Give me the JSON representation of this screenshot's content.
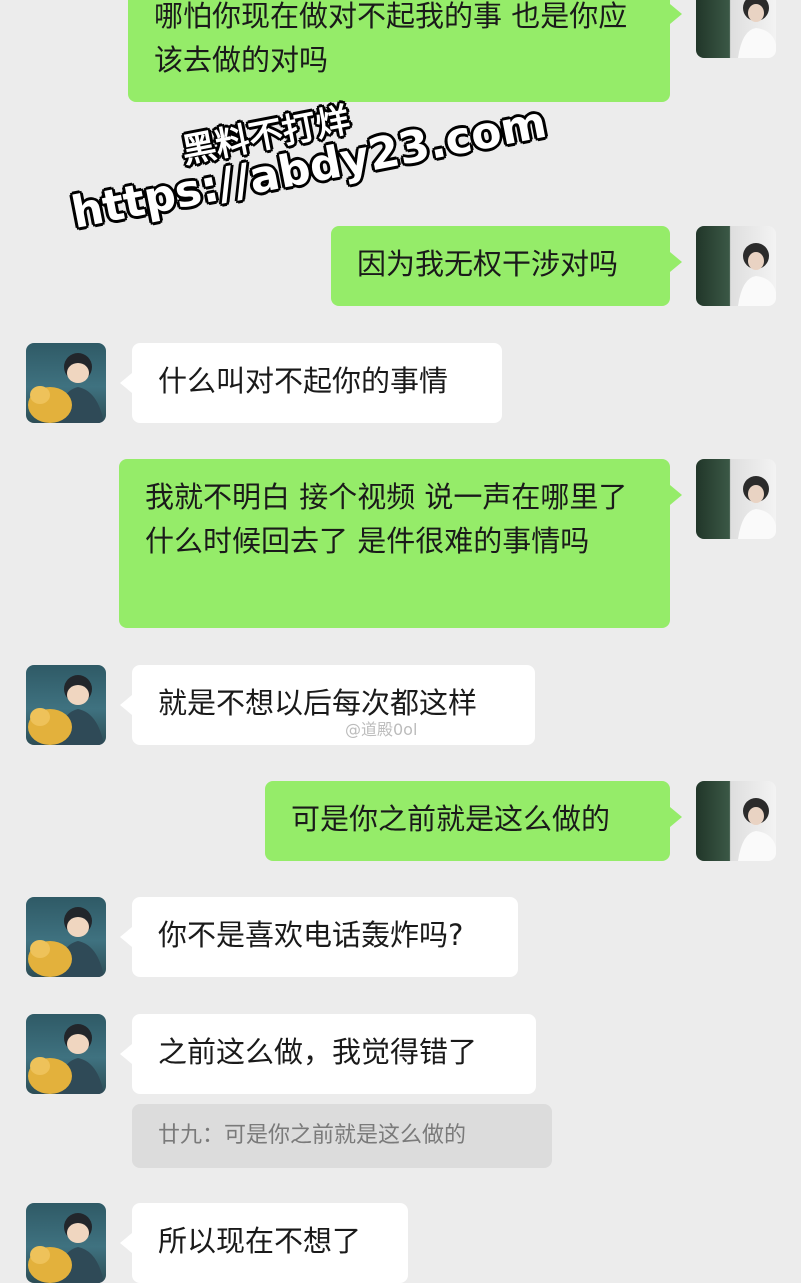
{
  "messages": [
    {
      "side": "right",
      "text": "哪怕你现在做对不起我的事 也是你应该去做的对吗"
    },
    {
      "side": "right",
      "text": "因为我无权干涉对吗"
    },
    {
      "side": "left",
      "text": "什么叫对不起你的事情"
    },
    {
      "side": "right",
      "text": "我就不明白 接个视频 说一声在哪里了 什么时候回去了 是件很难的事情吗"
    },
    {
      "side": "left",
      "text": "就是不想以后每次都这样"
    },
    {
      "side": "right",
      "text": "可是你之前就是这么做的"
    },
    {
      "side": "left",
      "text": "你不是喜欢电话轰炸吗?"
    },
    {
      "side": "left",
      "text": "之前这么做，我觉得错了"
    },
    {
      "side": "left",
      "text": "所以现在不想了"
    }
  ],
  "quote": {
    "text": "廿九：可是你之前就是这么做的"
  },
  "watermark": {
    "line1": "黑料不打烊",
    "line2": "https://abdy23.com"
  },
  "faint_overlay": "@道殿0ol"
}
